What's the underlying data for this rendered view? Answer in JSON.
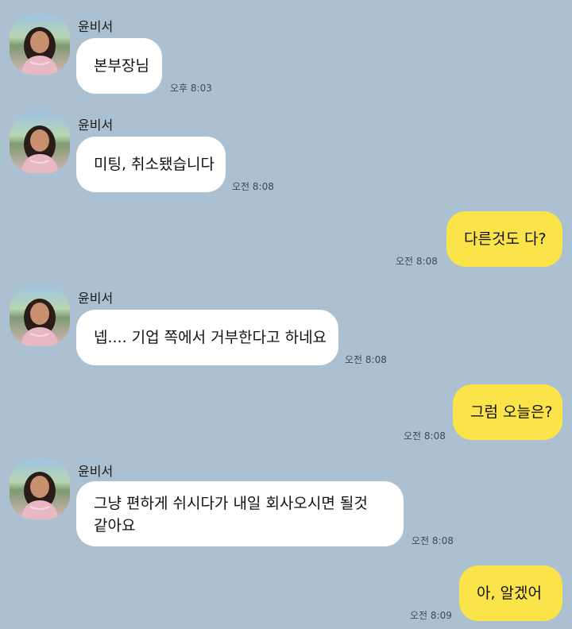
{
  "messages": [
    {
      "side": "in",
      "sender": "윤비서",
      "text": "본부장님",
      "time": "오후 8:03"
    },
    {
      "side": "in",
      "sender": "윤비서",
      "text": "미팅, 취소됐습니다",
      "time": "오전 8:08"
    },
    {
      "side": "out",
      "text": "다른것도 다?",
      "time": "오전 8:08"
    },
    {
      "side": "in",
      "sender": "윤비서",
      "text": "넵.... 기업 쪽에서 거부한다고 하네요",
      "time": "오전 8:08"
    },
    {
      "side": "out",
      "text": "그럼 오늘은?",
      "time": "오전 8:08"
    },
    {
      "side": "in",
      "sender": "윤비서",
      "text": "그냥 편하게 쉬시다가 내일 회사오시면 될것 같아요",
      "time": "오전 8:08"
    },
    {
      "side": "out",
      "text": "아, 알겠어",
      "time": "오전 8:09"
    }
  ],
  "colors": {
    "background": "#abc1d1",
    "incoming_bubble": "#ffffff",
    "outgoing_bubble": "#fbe34a"
  }
}
